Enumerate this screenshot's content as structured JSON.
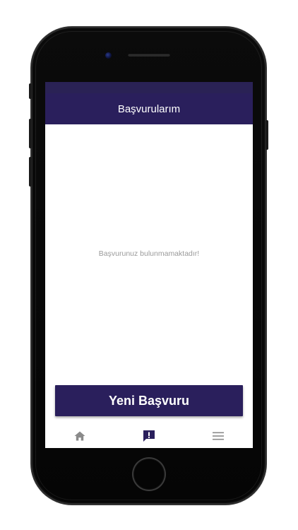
{
  "header": {
    "title": "Başvurularım"
  },
  "main": {
    "empty_message": "Başvurunuz bulunmamaktadır!"
  },
  "actions": {
    "new_application_label": "Yeni Başvuru"
  },
  "tabs": [
    {
      "icon": "home-icon",
      "active": false
    },
    {
      "icon": "alert-message-icon",
      "active": true
    },
    {
      "icon": "menu-icon",
      "active": false
    }
  ],
  "colors": {
    "primary": "#2a1f5c",
    "status_bar": "#2a2255",
    "muted_text": "#9a9a9a",
    "inactive_icon": "#8a8a8a",
    "device_body": "#0b0b0b"
  }
}
